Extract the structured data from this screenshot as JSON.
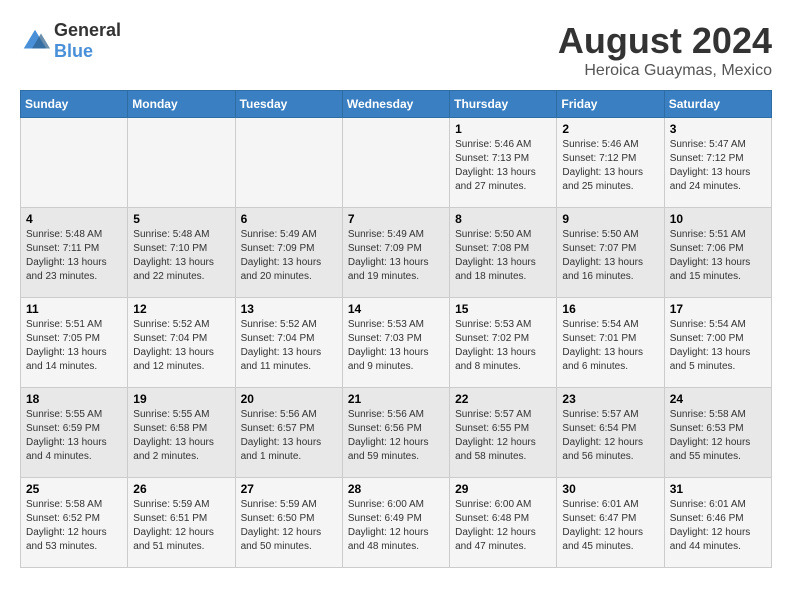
{
  "logo": {
    "text_general": "General",
    "text_blue": "Blue"
  },
  "title": "August 2024",
  "subtitle": "Heroica Guaymas, Mexico",
  "days_of_week": [
    "Sunday",
    "Monday",
    "Tuesday",
    "Wednesday",
    "Thursday",
    "Friday",
    "Saturday"
  ],
  "weeks": [
    {
      "days": [
        {
          "num": "",
          "info": ""
        },
        {
          "num": "",
          "info": ""
        },
        {
          "num": "",
          "info": ""
        },
        {
          "num": "",
          "info": ""
        },
        {
          "num": "1",
          "info": "Sunrise: 5:46 AM\nSunset: 7:13 PM\nDaylight: 13 hours\nand 27 minutes."
        },
        {
          "num": "2",
          "info": "Sunrise: 5:46 AM\nSunset: 7:12 PM\nDaylight: 13 hours\nand 25 minutes."
        },
        {
          "num": "3",
          "info": "Sunrise: 5:47 AM\nSunset: 7:12 PM\nDaylight: 13 hours\nand 24 minutes."
        }
      ]
    },
    {
      "days": [
        {
          "num": "4",
          "info": "Sunrise: 5:48 AM\nSunset: 7:11 PM\nDaylight: 13 hours\nand 23 minutes."
        },
        {
          "num": "5",
          "info": "Sunrise: 5:48 AM\nSunset: 7:10 PM\nDaylight: 13 hours\nand 22 minutes."
        },
        {
          "num": "6",
          "info": "Sunrise: 5:49 AM\nSunset: 7:09 PM\nDaylight: 13 hours\nand 20 minutes."
        },
        {
          "num": "7",
          "info": "Sunrise: 5:49 AM\nSunset: 7:09 PM\nDaylight: 13 hours\nand 19 minutes."
        },
        {
          "num": "8",
          "info": "Sunrise: 5:50 AM\nSunset: 7:08 PM\nDaylight: 13 hours\nand 18 minutes."
        },
        {
          "num": "9",
          "info": "Sunrise: 5:50 AM\nSunset: 7:07 PM\nDaylight: 13 hours\nand 16 minutes."
        },
        {
          "num": "10",
          "info": "Sunrise: 5:51 AM\nSunset: 7:06 PM\nDaylight: 13 hours\nand 15 minutes."
        }
      ]
    },
    {
      "days": [
        {
          "num": "11",
          "info": "Sunrise: 5:51 AM\nSunset: 7:05 PM\nDaylight: 13 hours\nand 14 minutes."
        },
        {
          "num": "12",
          "info": "Sunrise: 5:52 AM\nSunset: 7:04 PM\nDaylight: 13 hours\nand 12 minutes."
        },
        {
          "num": "13",
          "info": "Sunrise: 5:52 AM\nSunset: 7:04 PM\nDaylight: 13 hours\nand 11 minutes."
        },
        {
          "num": "14",
          "info": "Sunrise: 5:53 AM\nSunset: 7:03 PM\nDaylight: 13 hours\nand 9 minutes."
        },
        {
          "num": "15",
          "info": "Sunrise: 5:53 AM\nSunset: 7:02 PM\nDaylight: 13 hours\nand 8 minutes."
        },
        {
          "num": "16",
          "info": "Sunrise: 5:54 AM\nSunset: 7:01 PM\nDaylight: 13 hours\nand 6 minutes."
        },
        {
          "num": "17",
          "info": "Sunrise: 5:54 AM\nSunset: 7:00 PM\nDaylight: 13 hours\nand 5 minutes."
        }
      ]
    },
    {
      "days": [
        {
          "num": "18",
          "info": "Sunrise: 5:55 AM\nSunset: 6:59 PM\nDaylight: 13 hours\nand 4 minutes."
        },
        {
          "num": "19",
          "info": "Sunrise: 5:55 AM\nSunset: 6:58 PM\nDaylight: 13 hours\nand 2 minutes."
        },
        {
          "num": "20",
          "info": "Sunrise: 5:56 AM\nSunset: 6:57 PM\nDaylight: 13 hours\nand 1 minute."
        },
        {
          "num": "21",
          "info": "Sunrise: 5:56 AM\nSunset: 6:56 PM\nDaylight: 12 hours\nand 59 minutes."
        },
        {
          "num": "22",
          "info": "Sunrise: 5:57 AM\nSunset: 6:55 PM\nDaylight: 12 hours\nand 58 minutes."
        },
        {
          "num": "23",
          "info": "Sunrise: 5:57 AM\nSunset: 6:54 PM\nDaylight: 12 hours\nand 56 minutes."
        },
        {
          "num": "24",
          "info": "Sunrise: 5:58 AM\nSunset: 6:53 PM\nDaylight: 12 hours\nand 55 minutes."
        }
      ]
    },
    {
      "days": [
        {
          "num": "25",
          "info": "Sunrise: 5:58 AM\nSunset: 6:52 PM\nDaylight: 12 hours\nand 53 minutes."
        },
        {
          "num": "26",
          "info": "Sunrise: 5:59 AM\nSunset: 6:51 PM\nDaylight: 12 hours\nand 51 minutes."
        },
        {
          "num": "27",
          "info": "Sunrise: 5:59 AM\nSunset: 6:50 PM\nDaylight: 12 hours\nand 50 minutes."
        },
        {
          "num": "28",
          "info": "Sunrise: 6:00 AM\nSunset: 6:49 PM\nDaylight: 12 hours\nand 48 minutes."
        },
        {
          "num": "29",
          "info": "Sunrise: 6:00 AM\nSunset: 6:48 PM\nDaylight: 12 hours\nand 47 minutes."
        },
        {
          "num": "30",
          "info": "Sunrise: 6:01 AM\nSunset: 6:47 PM\nDaylight: 12 hours\nand 45 minutes."
        },
        {
          "num": "31",
          "info": "Sunrise: 6:01 AM\nSunset: 6:46 PM\nDaylight: 12 hours\nand 44 minutes."
        }
      ]
    }
  ]
}
